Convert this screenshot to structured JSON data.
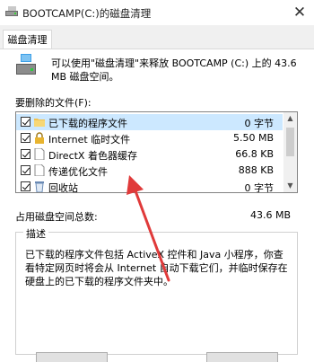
{
  "window": {
    "title": "BOOTCAMP(C:)的磁盘清理"
  },
  "tabs": [
    {
      "label": "磁盘清理"
    }
  ],
  "intro": {
    "text": "可以使用\"磁盘清理\"来释放 BOOTCAMP (C:) 上的 43.6 MB 磁盘空间。"
  },
  "list": {
    "label": "要删除的文件(F):",
    "items": [
      {
        "name": "已下载的程序文件",
        "size": "0 字节",
        "checked": true,
        "icon": "folder-icon"
      },
      {
        "name": "Internet 临时文件",
        "size": "5.50 MB",
        "checked": true,
        "icon": "lock-icon"
      },
      {
        "name": "DirectX 着色器缓存",
        "size": "66.8 KB",
        "checked": true,
        "icon": "file-icon"
      },
      {
        "name": "传递优化文件",
        "size": "888 KB",
        "checked": true,
        "icon": "file-icon"
      },
      {
        "name": "回收站",
        "size": "0 字节",
        "checked": true,
        "icon": "recycle-bin-icon"
      }
    ]
  },
  "total": {
    "label": "占用磁盘空间总数:",
    "value": "43.6 MB"
  },
  "description": {
    "title": "描述",
    "text": "已下载的程序文件包括 ActiveX 控件和 Java 小程序，你查看特定网页时将会从 Internet 自动下载它们，并临时保存在硬盘上的已下载的程序文件夹中。"
  },
  "colors": {
    "selection": "#cce8ff",
    "annotation_arrow": "#e03a3a"
  }
}
